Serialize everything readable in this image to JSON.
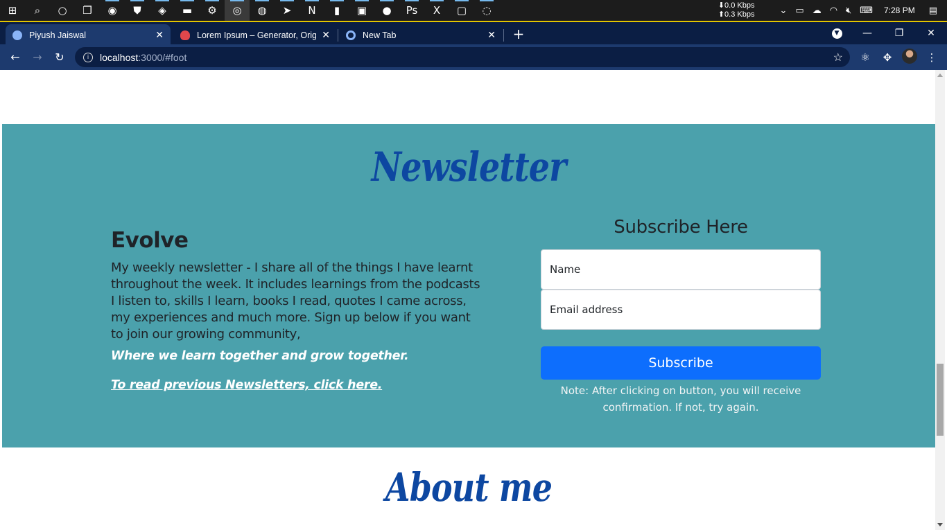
{
  "taskbar": {
    "apps": [
      {
        "icon": "start-icon",
        "glyph": "⊞"
      },
      {
        "icon": "search-icon",
        "glyph": "⌕"
      },
      {
        "icon": "cortana-icon",
        "glyph": "○"
      },
      {
        "icon": "task-view-icon",
        "glyph": "❐"
      },
      {
        "icon": "whatsapp-icon",
        "glyph": "◉"
      },
      {
        "icon": "shield-icon",
        "glyph": "⛊"
      },
      {
        "icon": "discord-icon",
        "glyph": "◈"
      },
      {
        "icon": "file-explorer-icon",
        "glyph": "▬"
      },
      {
        "icon": "settings-icon",
        "glyph": "⚙"
      },
      {
        "icon": "chrome-icon",
        "glyph": "◎"
      },
      {
        "icon": "spotify-icon",
        "glyph": "◍"
      },
      {
        "icon": "telegram-icon",
        "glyph": "➤"
      },
      {
        "icon": "notion-icon",
        "glyph": "N"
      },
      {
        "icon": "docs-icon",
        "glyph": "▮"
      },
      {
        "icon": "photos-icon",
        "glyph": "▣"
      },
      {
        "icon": "app-icon",
        "glyph": "●"
      },
      {
        "icon": "photoshop-icon",
        "glyph": "Ps"
      },
      {
        "icon": "xampp-icon",
        "glyph": "X"
      },
      {
        "icon": "terminal-icon",
        "glyph": "▢"
      },
      {
        "icon": "obs-icon",
        "glyph": "◌"
      }
    ],
    "net_down": "⬇0.0 Kbps",
    "net_up": "⬆0.3 Kbps",
    "time": "7:28 PM"
  },
  "browser": {
    "tabs": [
      {
        "title": "Piyush Jaiswal",
        "fav_color": "#8ab4f8"
      },
      {
        "title": "Lorem Ipsum – Generator, Origin",
        "fav_color": "#e0474c"
      },
      {
        "title": "New Tab",
        "fav_color": "#8ab4f8"
      }
    ],
    "close_glyph": "✕",
    "new_tab_glyph": "+",
    "url_host": "localhost",
    "url_path": ":3000/#foot"
  },
  "newsletter": {
    "title": "Newsletter",
    "heading": "Evolve",
    "description": "My weekly newsletter - I share all of the things I have learnt throughout the week. It includes learnings from the podcasts I listen to, skills I learn, books I read, quotes I came across, my experiences and much more. Sign up below if you want to join our growing community,",
    "tagline": "Where we learn together and grow together.",
    "previous_link": "To read previous Newsletters, click here.",
    "subscribe_heading": "Subscribe Here",
    "name_placeholder": "Name",
    "email_placeholder": "Email address",
    "subscribe_button": "Subscribe",
    "note": "Note: After clicking on button, you will receive confirmation. If not, try again."
  },
  "about": {
    "title": "About me"
  },
  "colors": {
    "section_bg": "#4ba1ac",
    "title": "#0d47a1",
    "button": "#0d6efd",
    "browser_frame": "#0b1e44",
    "browser_toolbar": "#1d3a6e"
  }
}
